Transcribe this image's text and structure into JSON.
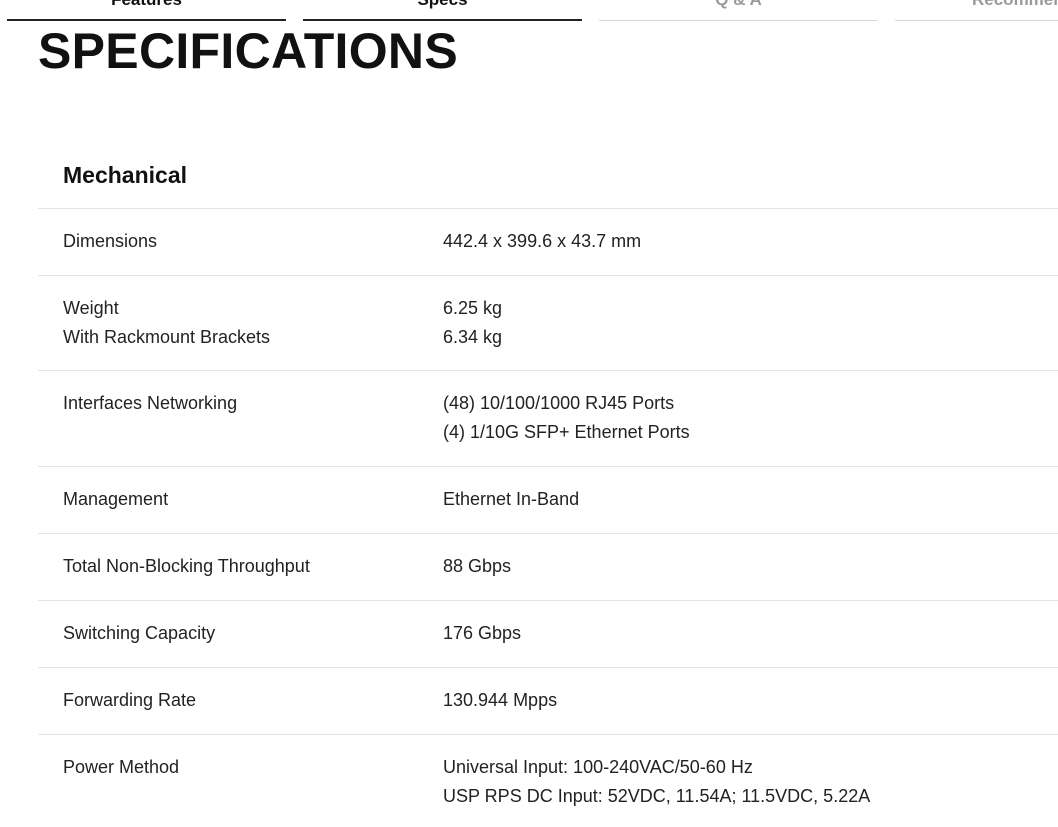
{
  "tabs": [
    {
      "label": "Features",
      "active": true
    },
    {
      "label": "Specs",
      "active": true
    },
    {
      "label": "Q & A",
      "active": false
    },
    {
      "label": "Recommen",
      "active": false
    }
  ],
  "page_title": "SPECIFICATIONS",
  "section": {
    "heading": "Mechanical",
    "rows": [
      {
        "labels": [
          "Dimensions"
        ],
        "values": [
          "442.4 x 399.6 x 43.7 mm"
        ]
      },
      {
        "labels": [
          "Weight",
          "With Rackmount Brackets"
        ],
        "values": [
          "6.25 kg",
          "6.34 kg"
        ]
      },
      {
        "labels": [
          "Interfaces Networking"
        ],
        "values": [
          "(48) 10/100/1000 RJ45 Ports",
          "(4) 1/10G SFP+ Ethernet Ports"
        ]
      },
      {
        "labels": [
          "Management"
        ],
        "values": [
          "Ethernet In-Band"
        ]
      },
      {
        "labels": [
          "Total Non-Blocking Throughput"
        ],
        "values": [
          "88 Gbps"
        ]
      },
      {
        "labels": [
          "Switching Capacity"
        ],
        "values": [
          "176 Gbps"
        ]
      },
      {
        "labels": [
          "Forwarding Rate"
        ],
        "values": [
          "130.944 Mpps"
        ]
      },
      {
        "labels": [
          "Power Method"
        ],
        "values": [
          "Universal Input: 100-240VAC/50-60 Hz",
          "USP RPS DC Input: 52VDC, 11.54A; 11.5VDC, 5.22A"
        ]
      }
    ]
  },
  "colors": {
    "text": "#222222",
    "divider": "#e4e4e4",
    "active_tab_underline": "#222222",
    "inactive_tab_text": "#9a9a9a"
  }
}
